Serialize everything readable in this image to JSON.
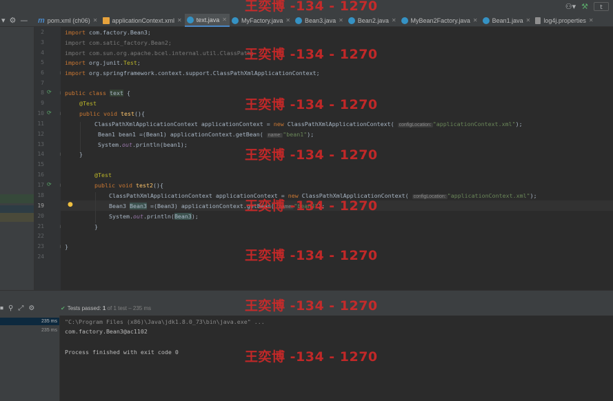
{
  "top": {
    "avatar_glyph": "⚇▾",
    "build_glyph": "⚒",
    "clip_text": "t"
  },
  "toolbar": {
    "settings_glyph": "⚙",
    "collapse_glyph": "—"
  },
  "tabs": [
    {
      "icon": "m",
      "label": "pom.xml (ch06)",
      "active": false
    },
    {
      "icon": "x",
      "label": "applicationContext.xml",
      "active": false
    },
    {
      "icon": "j",
      "label": "text.java",
      "active": true
    },
    {
      "icon": "c",
      "label": "MyFactory.java",
      "active": false
    },
    {
      "icon": "c",
      "label": "Bean3.java",
      "active": false
    },
    {
      "icon": "c",
      "label": "Bean2.java",
      "active": false
    },
    {
      "icon": "c",
      "label": "MyBean2Factory.java",
      "active": false
    },
    {
      "icon": "c",
      "label": "Bean1.java",
      "active": false
    },
    {
      "icon": "p",
      "label": "log4j.properties",
      "active": false
    }
  ],
  "line_numbers": [
    "2",
    "3",
    "4",
    "5",
    "6",
    "7",
    "8",
    "9",
    "10",
    "11",
    "12",
    "13",
    "14",
    "15",
    "16",
    "17",
    "18",
    "19",
    "20",
    "21",
    "22",
    "23",
    "24"
  ],
  "current_line": "19",
  "code": {
    "l2": {
      "kw": "import",
      "rest": " com.factory.Bean3;"
    },
    "l3": "import com.satic_factory.Bean2;",
    "l4": "import com.sun.org.apache.bcel.internal.util.ClassPath;",
    "l5": {
      "kw": "import",
      "rest": " org.junit.",
      "cls": "Test",
      "end": ";"
    },
    "l6": {
      "kw": "import",
      "rest": " org.springframework.context.support.ClassPathXmlApplicationContext;"
    },
    "l8": {
      "kw1": "public",
      "kw2": "class",
      "name": "text",
      "end": " {"
    },
    "l9": "@Test",
    "l10": {
      "kw1": "public",
      "kw2": "void",
      "name": "test",
      "end": "(){"
    },
    "l11": {
      "a": "ClassPathXmlApplicationContext applicationContext = ",
      "kw": "new",
      "b": " ClassPathXmlApplicationContext(",
      "hint": "configLocation:",
      "str": "\"applicationContext.xml\"",
      "end": ");"
    },
    "l12": {
      "a": "Bean1 bean1 =(Bean1) applicationContext.getBean(",
      "hint": "name:",
      "str": "\"bean1\"",
      "end": ");"
    },
    "l13": {
      "a": "System.",
      "fld": "out",
      "b": ".println(bean1);"
    },
    "l14": "}",
    "l16": "@Test",
    "l17": {
      "kw1": "public",
      "kw2": "void",
      "name": "test2",
      "end": "(){"
    },
    "l18": {
      "a": "ClassPathXmlApplicationContext applicationContext = ",
      "kw": "new",
      "b": " ClassPathXmlApplicationContext(",
      "hint": "configLocation:",
      "str": "\"applicationContext.xml\"",
      "end": ");"
    },
    "l19": {
      "a": "Bean3 ",
      "var": "Bean3",
      "b": " =(Bean3) applicationContext.getBean(",
      "hint": "name:",
      "str": "\"bean3\"",
      "end": ");"
    },
    "l20": {
      "a": "System.",
      "fld": "out",
      "b": ".println(",
      "var": "Bean3",
      "end": ");"
    },
    "l21": "}",
    "l23": "}"
  },
  "run": {
    "tools": [
      "⏹",
      "⚲",
      "⤢",
      "⚙"
    ],
    "passed_label": "Tests passed:",
    "passed_count": "1",
    "passed_detail": "of 1 test – 235 ms",
    "tree_times": [
      "235 ms",
      "235 ms"
    ],
    "console": [
      "\"C:\\Program Files (x86)\\Java\\jdk1.8.0_73\\bin\\java.exe\" ...",
      "com.factory.Bean3@ac1102",
      "",
      "Process finished with exit code 0"
    ]
  },
  "watermark": "王奕博 -134 - 1270",
  "colors": {
    "keyword": "#cc7832",
    "string": "#6a8759",
    "annotation": "#bbb529",
    "method": "#ffc66d",
    "field": "#9876aa",
    "watermark": "#dc2828",
    "pass": "#59a869"
  }
}
